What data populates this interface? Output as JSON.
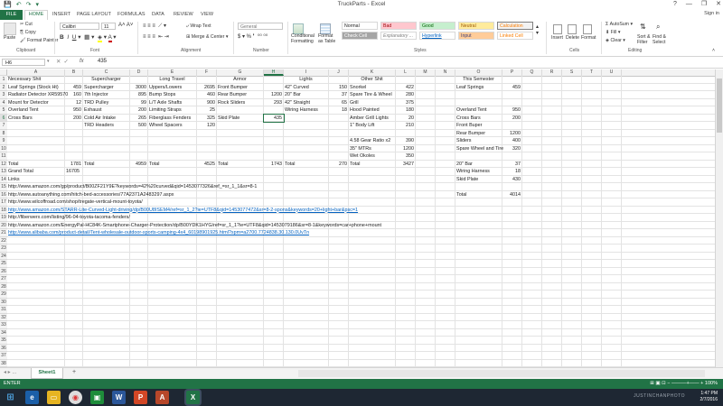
{
  "window": {
    "title": "TruckParts - Excel",
    "controls": [
      "?",
      "—",
      "❐",
      "✕"
    ]
  },
  "qat": [
    "💾",
    "↶",
    "↷",
    "▾"
  ],
  "tabs": [
    "FILE",
    "HOME",
    "INSERT",
    "PAGE LAYOUT",
    "FORMULAS",
    "DATA",
    "REVIEW",
    "VIEW"
  ],
  "signin": "Sign in",
  "ribbon": {
    "cut": "Cut",
    "copy": "Copy",
    "format_painter": "Format Painter",
    "paste": "Paste",
    "clipboard": "Clipboard",
    "font_name": "Calibri",
    "font_size": "11",
    "font": "Font",
    "wrap_text": "Wrap Text",
    "merge_center": "Merge & Center",
    "alignment": "Alignment",
    "number_format": "General",
    "number": "Number",
    "conditional": "Conditional Formatting",
    "format_table": "Format as Table",
    "styles_row1": [
      "Normal",
      "Bad",
      "Good",
      "Neutral",
      "Calculation"
    ],
    "styles_row2": [
      "Check Cell",
      "Explanatory ...",
      "Hyperlink",
      "Input",
      "Linked Cell"
    ],
    "styles": "Styles",
    "insert": "Insert",
    "delete": "Delete",
    "format": "Format",
    "cells": "Cells",
    "autosum": "AutoSum",
    "fill": "Fill",
    "clear": "Clear",
    "sort_filter": "Sort & Filter",
    "find_select": "Find & Select",
    "editing": "Editing"
  },
  "formula_bar": {
    "name_box": "H6",
    "fx": "fx",
    "value": "435"
  },
  "columns": [
    "A",
    "B",
    "C",
    "D",
    "E",
    "F",
    "G",
    "H",
    "I",
    "J",
    "K",
    "L",
    "M",
    "N",
    "O",
    "P",
    "Q",
    "R",
    "S",
    "T",
    "U"
  ],
  "rows": [
    "1",
    "2",
    "3",
    "4",
    "5",
    "6",
    "7",
    "8",
    "9",
    "10",
    "11",
    "12",
    "13",
    "14",
    "15",
    "16",
    "17",
    "18",
    "19",
    "20",
    "21",
    "22",
    "23",
    "24",
    "25",
    "26",
    "27",
    "28",
    "29",
    "30",
    "31",
    "32",
    "33",
    "34",
    "35",
    "36",
    "37",
    "38"
  ],
  "cells": {
    "headers": {
      "A1": "Necessary Shit",
      "C1": "Supercharger",
      "E1": "Long Travel",
      "G1": "Armor",
      "I1": "Lights",
      "K1": "Other Shit",
      "O1": "This Semester"
    },
    "col_A": [
      "Leaf Springs (Stock Ht)",
      "Radiator Detector XR59570",
      "Mount for Detector",
      "Overland Tent",
      "Cross Bars"
    ],
    "col_B": [
      "459",
      "160",
      "12",
      "950",
      "200"
    ],
    "col_C": [
      "Supercharger",
      "7th Injector",
      "TRD Pulley",
      "Exhaust",
      "Cold Air Intake",
      "TRD Headers"
    ],
    "col_D": [
      "3000",
      "895",
      "99",
      "200",
      "265",
      "500"
    ],
    "col_E": [
      "Uppers/Lowers",
      "Bump Stops",
      "L/T Axle Shafts",
      "Limiting Straps",
      "Fiberglass Fenders",
      "Wheel Spacers"
    ],
    "col_F": [
      "2695",
      "460",
      "900",
      "25",
      "325",
      "120"
    ],
    "col_G": [
      "Front Bumper",
      "Rear Bumper",
      "Rock Sliders",
      "",
      "Skid Plate"
    ],
    "col_H": [
      "",
      "1200",
      "293",
      "",
      "435"
    ],
    "col_I": [
      "42\" Curved",
      "20\" Bar",
      "42\" Straight",
      "Wiring Harness"
    ],
    "col_J": [
      "150",
      "37",
      "65",
      "18"
    ],
    "col_K": [
      "Snorkel",
      "Spare Tire & Wheel",
      "Grill",
      "Hood Painted",
      "Amber Grill Lights",
      "1\" Body Lift",
      "",
      "4.58 Gear Ratio x2",
      "35\" MTRs",
      "Wet Okoles"
    ],
    "col_L": [
      "422",
      "280",
      "375",
      "180",
      "20",
      "210",
      "",
      "390",
      "1200",
      "350"
    ],
    "col_O": [
      "Leaf Springs",
      "",
      "",
      "Overland Tent",
      "Cross Bars",
      "Front Buper",
      "Rear Bumper",
      "Sliders",
      "Spare Wheel and Tire",
      "",
      "20\" Bar",
      "Wiring Harness",
      "Skid Plate",
      "",
      "Total"
    ],
    "col_P": [
      "459",
      "",
      "",
      "950",
      "200",
      "",
      "1200",
      "400",
      "320",
      "",
      "37",
      "18",
      "430",
      "",
      "4014"
    ],
    "totals": {
      "A12": "Total",
      "B12": "1781",
      "C12": "Total",
      "D12": "4959",
      "E12": "Total",
      "F12": "4525",
      "G12": "Total",
      "H12": "1743",
      "I12": "Total",
      "J12": "270",
      "K12": "Total",
      "L12": "3427"
    },
    "grand_total_label": "Grand Total",
    "grand_total": "16705",
    "links_label": "Links",
    "links": [
      "http://www.amazon.com/gp/product/B00ZF21Y9E?keywords=42%20curved&qid=1453077326&ref_=sr_1_1&sr=8-1",
      "http://www.autoanything.com/hitch-bed-accessories/77A2371A2483297.aspx",
      "http://www.wilcoffroad.com/shop/tregate-vertical-mount-toyota/",
      "http://www.amazon.com/STARR-Lite-Curved-Light-driving/dp/B00U8ISEM4/ref=sr_1_2?ie=UTF8&qid=1453077472&sr=8-2-spons&keywords=20+light+bar&psc=1",
      "http://fiberwerx.com/listing/96-04-toyota-tacoma-fenders/",
      "http://www.amazon.com/EnergyPal-HC84K-Smartphone-Charger-Protection/dp/B00YDK1HYG/ref=sr_1_1?ie=UTF8&qid=1453079186&sr=8-1&keywords=car+phone+mount",
      "http://www.alibaba.com/product-detail/Tent-wholesale-outdoor-sports-camping-4x4_60198901925.html?spm=a2700.7724838.30.130.0UvTn"
    ]
  },
  "sheet_tabs": [
    "Sheet1"
  ],
  "add_sheet": "+",
  "status": "ENTER",
  "status_right": "⊞  ▣  ⊡   −  ———+——  +  100%",
  "taskbar": {
    "watermark": "JUSTINCHANPHOTO",
    "time": "1:47 PM",
    "date": "2/7/2016"
  },
  "colors": {
    "accent": "#217346",
    "link": "#0563c1",
    "taskbar": "#1e2733"
  }
}
